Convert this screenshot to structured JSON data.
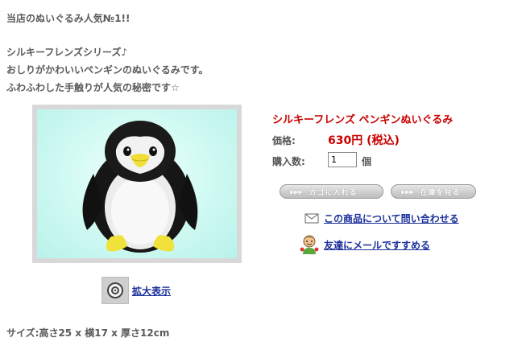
{
  "intro": {
    "line1": "当店のぬいぐるみ人気№1!!",
    "line2": "シルキーフレンズシリーズ♪",
    "line3": "おしりがかわいいペンギンのぬいぐるみです。",
    "line4": "ふわふわした手触りが人気の秘密です☆"
  },
  "product": {
    "name": "シルキーフレンズ ペンギンぬいぐるみ",
    "price_label": "価格:",
    "price": "630円 (税込)",
    "qty_label": "購入数:",
    "qty_value": "1",
    "qty_unit": "個"
  },
  "buttons": {
    "cart": "カゴに入れる",
    "stock": "在庫を見る",
    "arrows": "▶▶▶"
  },
  "links": {
    "inquiry": "この商品について問い合わせる",
    "recommend": "友達にメールですすめる",
    "zoom": "拡大表示"
  },
  "size_text": "サイズ:高さ25 x 横17 x 厚さ12cm",
  "icons": {
    "envelope": "envelope-icon",
    "friend": "friend-icon",
    "zoom": "magnifier-icon"
  },
  "colors": {
    "accent_red": "#cc0000",
    "link_blue": "#1a2f9a",
    "photo_background": "#c8f6ef"
  }
}
